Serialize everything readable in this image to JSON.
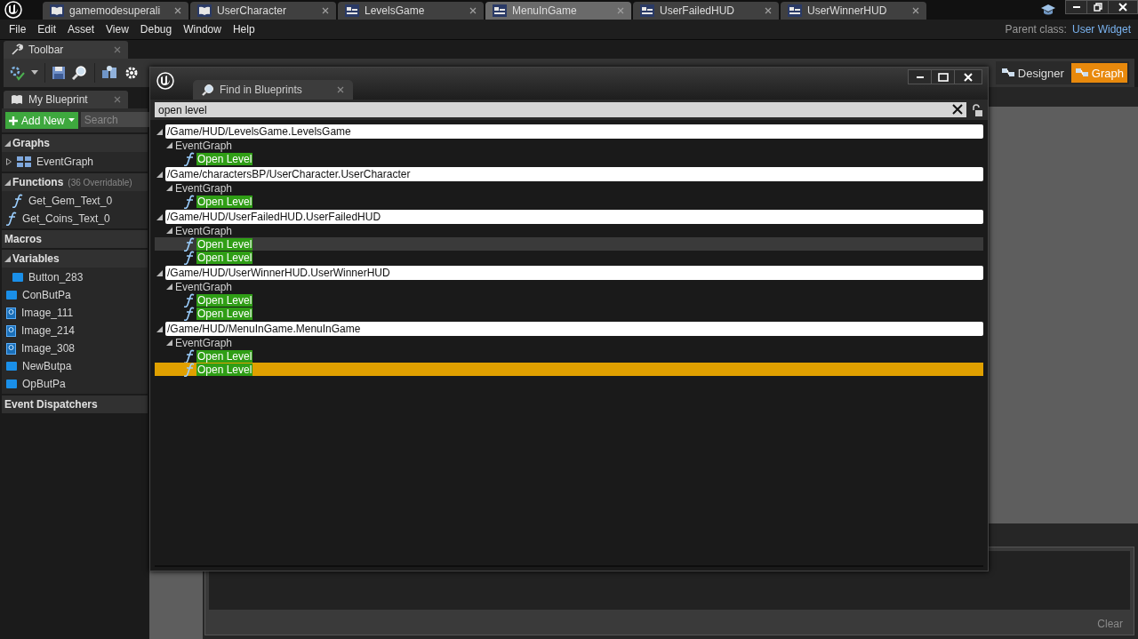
{
  "document_tabs": [
    {
      "label": "gamemodesuperali",
      "kind": "blueprint",
      "selected": false
    },
    {
      "label": "UserCharacter",
      "kind": "blueprint",
      "selected": false
    },
    {
      "label": "LevelsGame",
      "kind": "widget",
      "selected": false
    },
    {
      "label": "MenuInGame",
      "kind": "widget",
      "selected": true
    },
    {
      "label": "UserFailedHUD",
      "kind": "widget",
      "selected": false
    },
    {
      "label": "UserWinnerHUD",
      "kind": "widget",
      "selected": false
    }
  ],
  "menu": [
    "File",
    "Edit",
    "Asset",
    "View",
    "Debug",
    "Window",
    "Help"
  ],
  "parent_class": {
    "label": "Parent class:",
    "value": "User Widget"
  },
  "toolbar_tab": {
    "label": "Toolbar"
  },
  "mode_buttons": [
    {
      "label": "Designer",
      "selected": false
    },
    {
      "label": "Graph",
      "selected": true
    }
  ],
  "my_blueprint": {
    "tab": "My Blueprint",
    "add_new": "Add New",
    "search": {
      "placeholder": "Search"
    },
    "sections": [
      {
        "title": "Graphs",
        "items": [
          {
            "label": "EventGraph",
            "kind": "graph",
            "expanded": false
          }
        ]
      },
      {
        "title": "Functions",
        "note": "(36 Overridable)",
        "items": [
          {
            "label": "Get_Gem_Text_0",
            "kind": "function"
          },
          {
            "label": "Get_Coins_Text_0",
            "kind": "function"
          }
        ]
      },
      {
        "title": "Macros"
      },
      {
        "title": "Variables",
        "items": [
          {
            "label": "Button_283",
            "kind": "variable"
          },
          {
            "label": "ConButPa",
            "kind": "variable"
          },
          {
            "label": "Image_111",
            "kind": "image"
          },
          {
            "label": "Image_214",
            "kind": "image"
          },
          {
            "label": "Image_308",
            "kind": "image"
          },
          {
            "label": "NewButpa",
            "kind": "variable"
          },
          {
            "label": "OpButPa",
            "kind": "variable"
          }
        ]
      },
      {
        "title": "Event Dispatchers"
      }
    ]
  },
  "find_window": {
    "tab": "Find in Blueprints",
    "search": {
      "value": "open level"
    },
    "results": [
      {
        "path": "/Game/HUD/LevelsGame.LevelsGame",
        "children": [
          {
            "label": "EventGraph",
            "children": [
              {
                "label": "Open Level",
                "selected": false,
                "hovered": false
              }
            ]
          }
        ]
      },
      {
        "path": "/Game/charactersBP/UserCharacter.UserCharacter",
        "children": [
          {
            "label": "EventGraph",
            "children": [
              {
                "label": "Open Level",
                "selected": false,
                "hovered": false
              }
            ]
          }
        ]
      },
      {
        "path": "/Game/HUD/UserFailedHUD.UserFailedHUD",
        "children": [
          {
            "label": "EventGraph",
            "children": [
              {
                "label": "Open Level",
                "selected": false,
                "hovered": true
              },
              {
                "label": "Open Level",
                "selected": false,
                "hovered": false
              }
            ]
          }
        ]
      },
      {
        "path": "/Game/HUD/UserWinnerHUD.UserWinnerHUD",
        "children": [
          {
            "label": "EventGraph",
            "children": [
              {
                "label": "Open Level",
                "selected": false,
                "hovered": false
              },
              {
                "label": "Open Level",
                "selected": false,
                "hovered": false
              }
            ]
          }
        ]
      },
      {
        "path": "/Game/HUD/MenuInGame.MenuInGame",
        "children": [
          {
            "label": "EventGraph",
            "children": [
              {
                "label": "Open Level",
                "selected": false,
                "hovered": false
              },
              {
                "label": "Open Level",
                "selected": true,
                "hovered": false
              }
            ]
          }
        ]
      }
    ]
  },
  "log": {
    "clear_button": "Clear"
  }
}
